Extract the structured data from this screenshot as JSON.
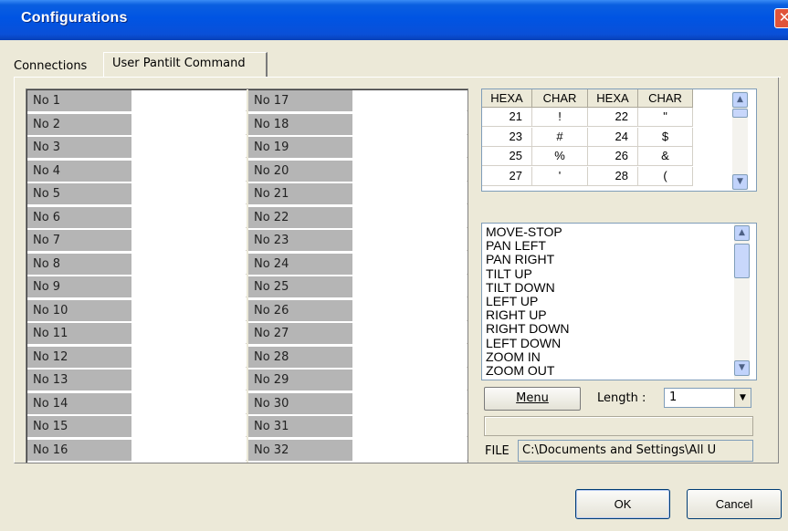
{
  "window": {
    "title": "Configurations",
    "close": "✕"
  },
  "tabs": [
    {
      "label": "Connections"
    },
    {
      "label": "User Pantilt Command"
    }
  ],
  "commands_left": [
    "No 1",
    "No 2",
    "No 3",
    "No 4",
    "No 5",
    "No 6",
    "No 7",
    "No 8",
    "No 9",
    "No 10",
    "No 11",
    "No 12",
    "No 13",
    "No 14",
    "No 15",
    "No 16"
  ],
  "commands_right": [
    "No 17",
    "No 18",
    "No 19",
    "No 20",
    "No 21",
    "No 22",
    "No 23",
    "No 24",
    "No 25",
    "No 26",
    "No 27",
    "No 28",
    "No 29",
    "No 30",
    "No 31",
    "No 32"
  ],
  "hex_table": {
    "headers": [
      "HEXA",
      "CHAR",
      "HEXA",
      "CHAR"
    ],
    "rows": [
      [
        "21",
        "!",
        "22",
        "\""
      ],
      [
        "23",
        "#",
        "24",
        "$"
      ],
      [
        "25",
        "%",
        "26",
        "&"
      ],
      [
        "27",
        "'",
        "28",
        "("
      ]
    ]
  },
  "command_list": [
    "MOVE-STOP",
    "PAN LEFT",
    "PAN RIGHT",
    "TILT UP",
    "TILT DOWN",
    "LEFT UP",
    "RIGHT UP",
    "RIGHT DOWN",
    "LEFT DOWN",
    "ZOOM IN",
    "ZOOM OUT"
  ],
  "menu_button": {
    "label": "Menu"
  },
  "length": {
    "label": "Length :",
    "value": "1"
  },
  "file": {
    "label": "FILE",
    "value": "C:\\Documents and Settings\\All U"
  },
  "buttons": {
    "ok": "OK",
    "cancel": "Cancel"
  },
  "colors": {
    "titlebar": "#0054e3",
    "face": "#ece9d8",
    "label_cell": "#b5b5b5",
    "close": "#e0543a"
  }
}
